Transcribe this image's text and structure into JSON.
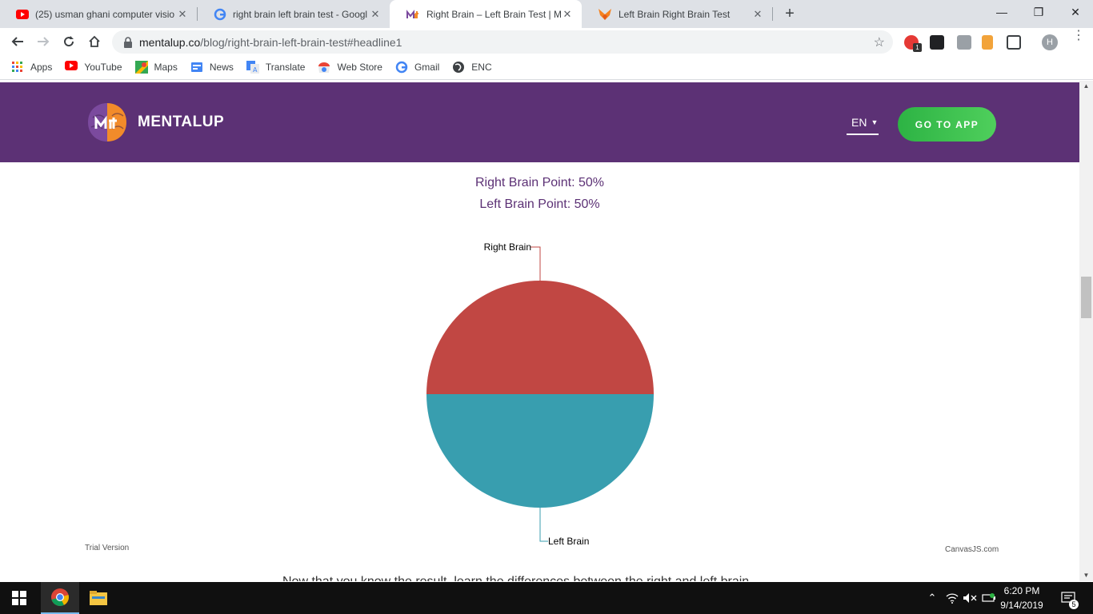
{
  "browser": {
    "tabs": [
      {
        "title": "(25) usman ghani computer visio",
        "icon": "youtube-icon"
      },
      {
        "title": "right brain left brain test - Googl",
        "icon": "google-icon"
      },
      {
        "title": "Right Brain – Left Brain Test | Me",
        "icon": "mentalup-icon"
      },
      {
        "title": "Left Brain Right Brain Test",
        "icon": "firefox-fox-icon"
      }
    ],
    "active_tab_index": 2,
    "url_host": "mentalup.co",
    "url_path": "/blog/right-brain-left-brain-test#headline1",
    "profile_initial": "H",
    "extension_badge": "1",
    "bookmarks": [
      {
        "label": "Apps",
        "icon": "apps-grid-icon"
      },
      {
        "label": "YouTube",
        "icon": "youtube-icon"
      },
      {
        "label": "Maps",
        "icon": "maps-icon"
      },
      {
        "label": "News",
        "icon": "news-icon"
      },
      {
        "label": "Translate",
        "icon": "translate-icon"
      },
      {
        "label": "Web Store",
        "icon": "web-store-icon"
      },
      {
        "label": "Gmail",
        "icon": "google-icon"
      },
      {
        "label": "ENC",
        "icon": "globe-icon"
      }
    ]
  },
  "site": {
    "brand": "MENTALUP",
    "language": "EN",
    "cta": "GO TO APP",
    "colors": {
      "header": "#5c3175",
      "cta": "#3cc24f"
    }
  },
  "results": {
    "right_line": "Right Brain Point: 50%",
    "left_line": "Left Brain Point: 50%"
  },
  "chart_data": {
    "type": "pie",
    "slices": [
      {
        "label": "Right Brain",
        "value": 50,
        "color": "#c14743"
      },
      {
        "label": "Left Brain",
        "value": 50,
        "color": "#389eaf"
      }
    ],
    "watermark": "Trial Version",
    "credit": "CanvasJS.com"
  },
  "cut_off_text": "Now that you know the result, learn the differences between the right and left brain.",
  "taskbar": {
    "time": "6:20 PM",
    "date": "9/14/2019",
    "notification_count": "5"
  }
}
